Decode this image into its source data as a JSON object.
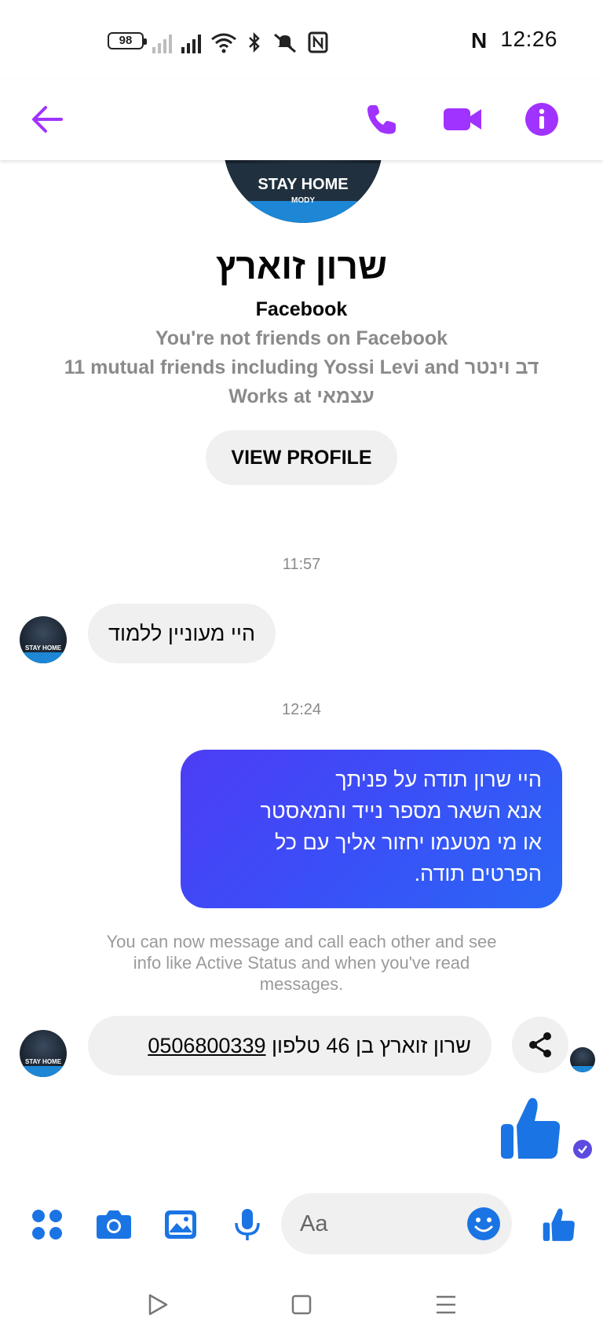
{
  "status_bar": {
    "battery": "98",
    "time": "12:26",
    "n_icon": "N"
  },
  "header": {
    "back_icon": "arrow-left-icon",
    "call_icon": "phone-icon",
    "video_icon": "video-camera-icon",
    "info_icon": "info-icon",
    "accent_color": "#a033ff"
  },
  "profile": {
    "avatar_text": "STAY HOME",
    "avatar_subtext": "MODY",
    "name": "שרון זוארץ",
    "platform": "Facebook",
    "friend_status": "You're not friends on Facebook",
    "mutual_friends": "11 mutual friends including Yossi Levi and דב וינטר",
    "works_at": "Works at עצמאי",
    "view_profile_label": "VIEW PROFILE"
  },
  "messages": {
    "time_1": "11:57",
    "incoming_1": "היי מעוניין ללמוד",
    "time_2": "12:24",
    "outgoing_lines": [
      "היי שרון תודה על פניתך",
      "אנא השאר מספר נייד והמאסטר",
      "או מי מטעמו יחזור אליך עם כל",
      "הפרטים תודה."
    ],
    "notice": "You can now message and call each other and see info like Active Status and when you've read messages.",
    "incoming_2_text": "שרון זוארץ בן 46 טלפון",
    "incoming_2_phone": "0506800339",
    "share_icon": "share-icon",
    "like_icon": "thumbs-up-icon",
    "outgoing_color": "#3a4ff7",
    "like_color": "#1b74e4"
  },
  "composer": {
    "placeholder": "Aa",
    "apps_icon": "apps-grid-icon",
    "camera_icon": "camera-icon",
    "gallery_icon": "image-icon",
    "mic_icon": "microphone-icon",
    "emoji_icon": "emoji-icon",
    "like_icon": "thumbs-up-icon",
    "icon_color": "#1b74e4"
  },
  "nav_bar": {
    "back_icon": "triangle-back-icon",
    "home_icon": "square-home-icon",
    "menu_icon": "menu-icon"
  }
}
